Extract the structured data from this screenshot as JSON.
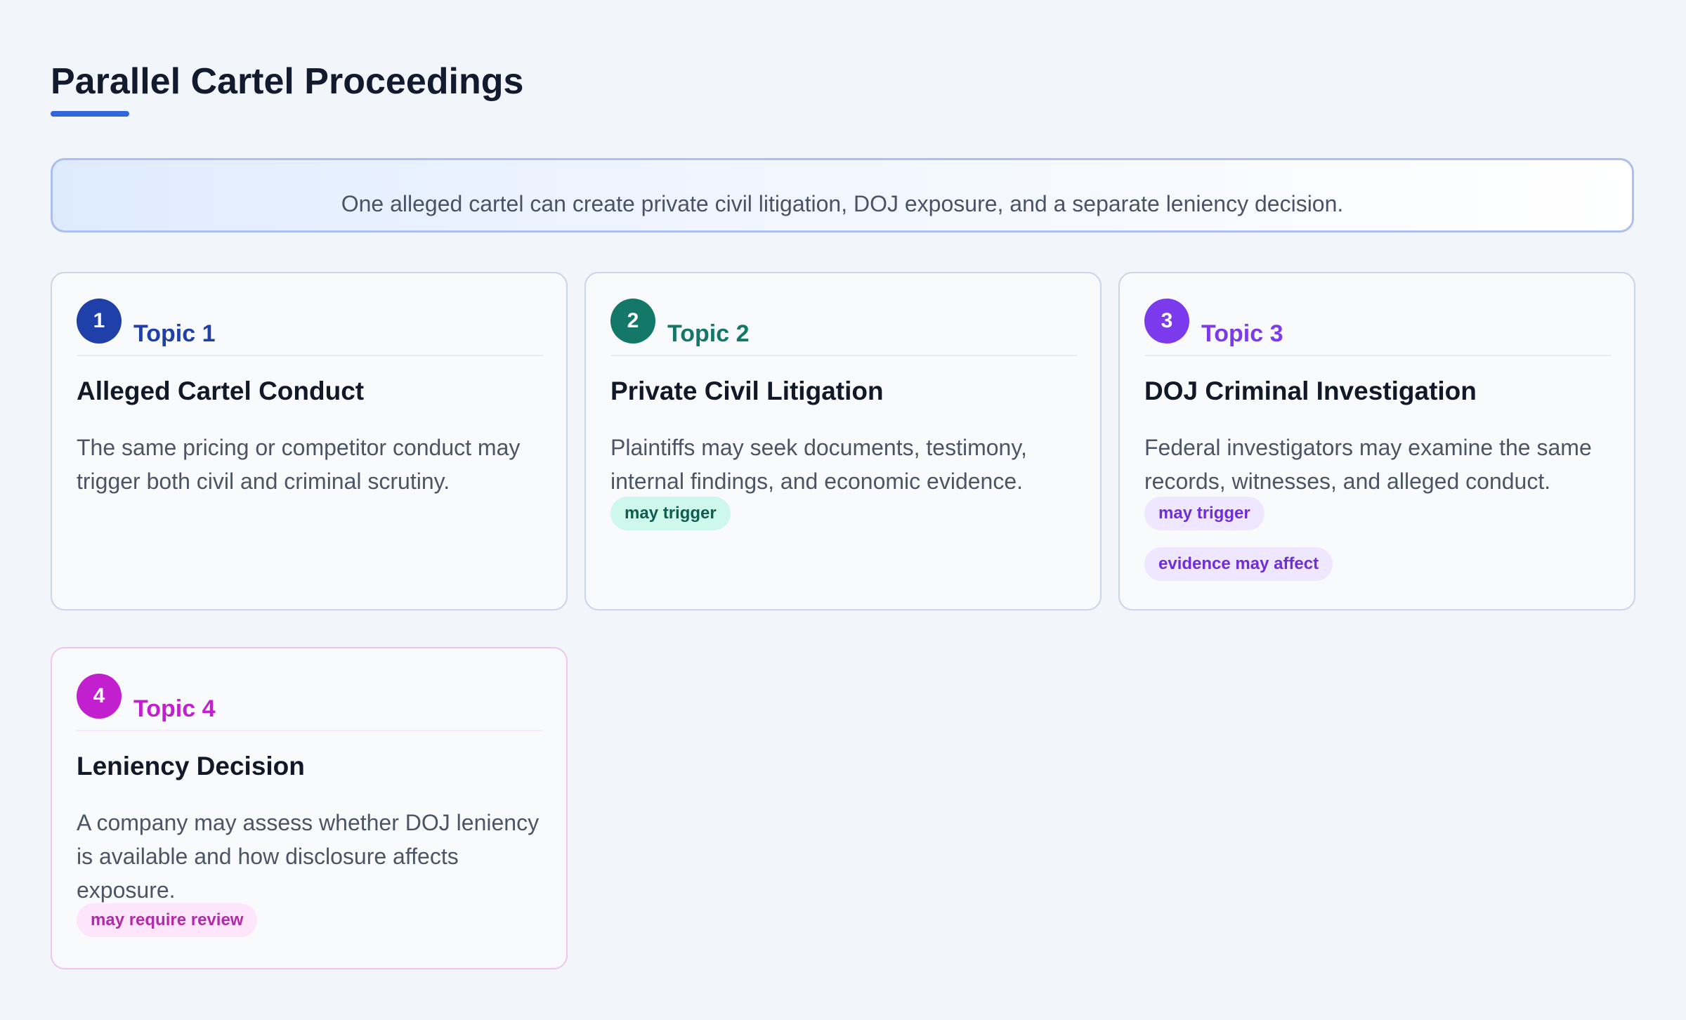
{
  "title": "Parallel Cartel Proceedings",
  "summary": "One alleged cartel can create private civil litigation, DOJ exposure, and a separate leniency decision.",
  "colors": {
    "accent": "#2f66e0",
    "background": "#f2f5fa",
    "topic_1": "#1f3fa9",
    "topic_2": "#137868",
    "topic_3": "#7c3aed",
    "topic_4": "#c21fcf"
  },
  "cards": [
    {
      "number": "1",
      "topic": "Topic 1",
      "title": "Alleged Cartel Conduct",
      "body": "The same pricing or competitor conduct may trigger both civil and criminal scrutiny.",
      "tags": []
    },
    {
      "number": "2",
      "topic": "Topic 2",
      "title": "Private Civil Litigation",
      "body": "Plaintiffs may seek documents, testimony, internal findings, and economic evidence.",
      "tags": [
        "may trigger"
      ]
    },
    {
      "number": "3",
      "topic": "Topic 3",
      "title": "DOJ Criminal Investigation",
      "body": "Federal investigators may examine the same records, witnesses, and alleged conduct.",
      "tags": [
        "may trigger",
        "evidence may affect"
      ]
    },
    {
      "number": "4",
      "topic": "Topic 4",
      "title": "Leniency Decision",
      "body": "A company may assess whether DOJ leniency is available and how disclosure affects exposure.",
      "tags": [
        "may require review"
      ]
    }
  ]
}
